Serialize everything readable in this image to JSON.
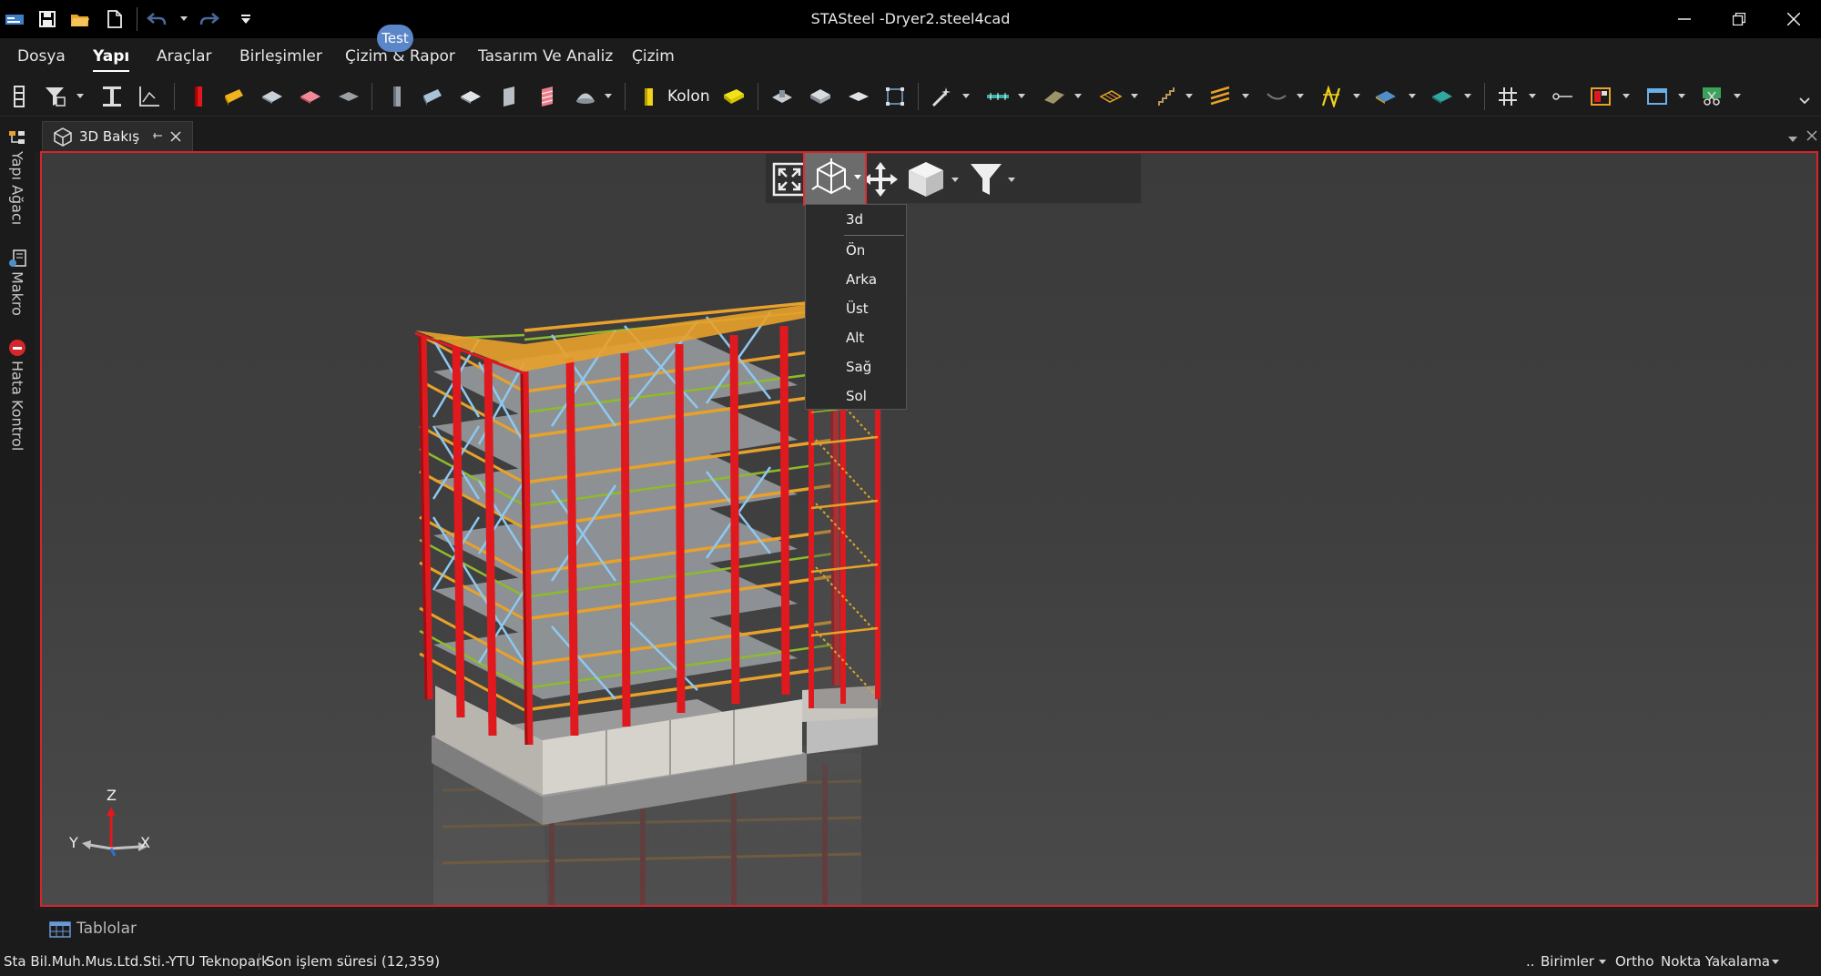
{
  "window": {
    "title": "STASteel -Dryer2.steel4cad"
  },
  "menu": {
    "items": [
      "Dosya",
      "Yapı",
      "Araçlar",
      "Birleşimler",
      "Çizim & Rapor",
      "Tasarım Ve Analiz",
      "Çizim"
    ],
    "active": "Yapı",
    "badge": "Test"
  },
  "ribbon": {
    "kolon_label": "Kolon"
  },
  "side_panel": {
    "tabs": [
      "Yapı Ağacı",
      "Makro",
      "Hata Kontrol"
    ]
  },
  "document_tab": {
    "label": "3D Bakış"
  },
  "view_menu": {
    "items": [
      "3d",
      "Ön",
      "Arka",
      "Üst",
      "Alt",
      "Sağ",
      "Sol"
    ]
  },
  "axis": {
    "z": "Z",
    "y": "Y",
    "x": "X"
  },
  "bottom_panel": {
    "label": "Tablolar"
  },
  "status": {
    "company": "Sta Bil.Muh.Mus.Ltd.Sti.-YTU Teknopark",
    "last_op": "Son işlem süresi (12,359)",
    "dots": "..",
    "units": "Birimler",
    "ortho": "Ortho",
    "snap": "Nokta Yakalama"
  },
  "colors": {
    "accent_red": "#d4262b",
    "column_red": "#e0191e",
    "beam_orange": "#e8a12a",
    "brace_blue": "#8ec8f0",
    "purlin_green": "#8dbb2b"
  }
}
